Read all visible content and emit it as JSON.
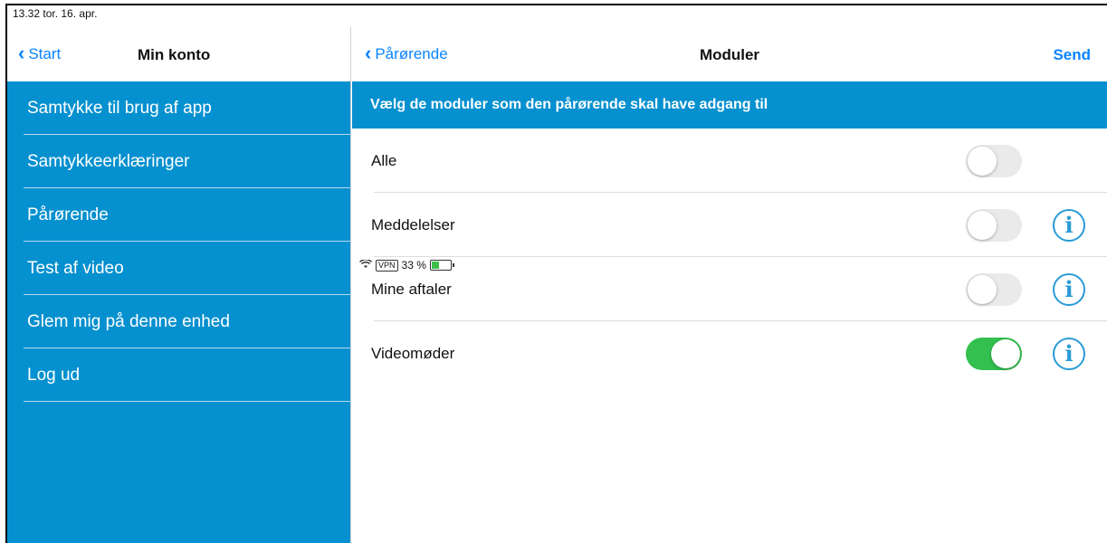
{
  "status": {
    "time": "13.32",
    "date": "tor. 16. apr.",
    "vpn": "VPN",
    "battery": "33 %"
  },
  "left_panel": {
    "back_label": "Start",
    "title": "Min konto",
    "menu": [
      {
        "label": "Samtykke til brug af app"
      },
      {
        "label": "Samtykkeerklæringer"
      },
      {
        "label": "Pårørende"
      },
      {
        "label": "Test af video"
      },
      {
        "label": "Glem mig på denne enhed"
      },
      {
        "label": "Log ud"
      }
    ]
  },
  "right_panel": {
    "back_label": "Pårørende",
    "title": "Moduler",
    "send_label": "Send",
    "section_header": "Vælg de moduler som den pårørende skal have adgang til",
    "rows": [
      {
        "label": "Alle",
        "enabled": false,
        "has_info": false
      },
      {
        "label": "Meddelelser",
        "enabled": false,
        "has_info": true
      },
      {
        "label": "Mine aftaler",
        "enabled": false,
        "has_info": true
      },
      {
        "label": "Videomøder",
        "enabled": true,
        "has_info": true
      }
    ]
  },
  "colors": {
    "brand_blue": "#0590cf",
    "link_blue": "#0a84ff",
    "toggle_on": "#33c04f"
  }
}
